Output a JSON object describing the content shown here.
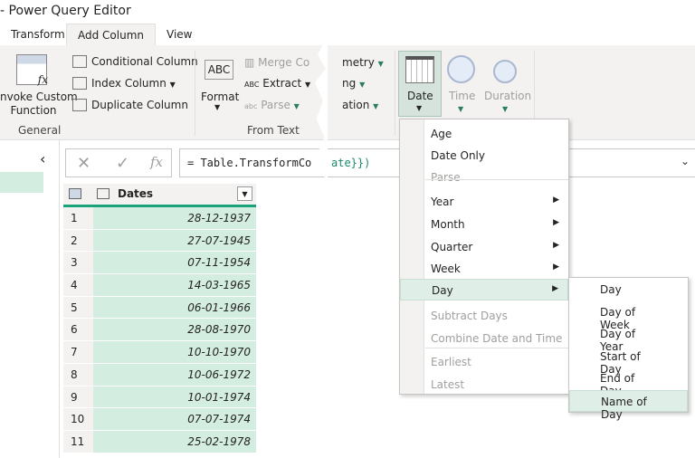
{
  "window": {
    "title": "- Power Query Editor"
  },
  "tabs": [
    {
      "label": "Transform"
    },
    {
      "label": "Add Column"
    },
    {
      "label": "View"
    }
  ],
  "ribbon": {
    "general": {
      "invoke": "Invoke Custom Function",
      "invoke_l1": "nvoke Custom",
      "invoke_l2": "Function",
      "group": "General"
    },
    "columns": {
      "conditional": "Conditional Column",
      "index": "Index Column",
      "duplicate": "Duplicate Column"
    },
    "from_text": {
      "format": "Format",
      "merge": "Merge Co",
      "extract": "Extract",
      "parse": "Parse",
      "group": "From Text"
    },
    "partial": {
      "a": "metry",
      "b": "ng",
      "c": "ation"
    },
    "date_time": {
      "date": "Date",
      "time": "Time",
      "duration": "Duration"
    }
  },
  "formula": {
    "left": "= Table.TransformCo",
    "right": "ate}})"
  },
  "table": {
    "header": "Dates",
    "rows": [
      {
        "n": "1",
        "v": "28-12-1937"
      },
      {
        "n": "2",
        "v": "27-07-1945"
      },
      {
        "n": "3",
        "v": "07-11-1954"
      },
      {
        "n": "4",
        "v": "14-03-1965"
      },
      {
        "n": "5",
        "v": "06-01-1966"
      },
      {
        "n": "6",
        "v": "28-08-1970"
      },
      {
        "n": "7",
        "v": "10-10-1970"
      },
      {
        "n": "8",
        "v": "10-06-1972"
      },
      {
        "n": "9",
        "v": "10-01-1974"
      },
      {
        "n": "10",
        "v": "07-07-1974"
      },
      {
        "n": "11",
        "v": "25-02-1978"
      }
    ]
  },
  "date_menu": {
    "items": [
      "Age",
      "Date Only",
      "Parse",
      "Year",
      "Month",
      "Quarter",
      "Week",
      "Day",
      "Subtract Days",
      "Combine Date and Time",
      "Earliest",
      "Latest"
    ]
  },
  "day_submenu": {
    "items": [
      "Day",
      "Day of Week",
      "Day of Year",
      "Start of Day",
      "End of Day",
      "Name of Day"
    ]
  },
  "colors": {
    "accent": "#1aa37a",
    "selected_bg": "#dfeee7",
    "cell_bg": "#d4ede1",
    "date_btn": "#d5e3dc"
  }
}
